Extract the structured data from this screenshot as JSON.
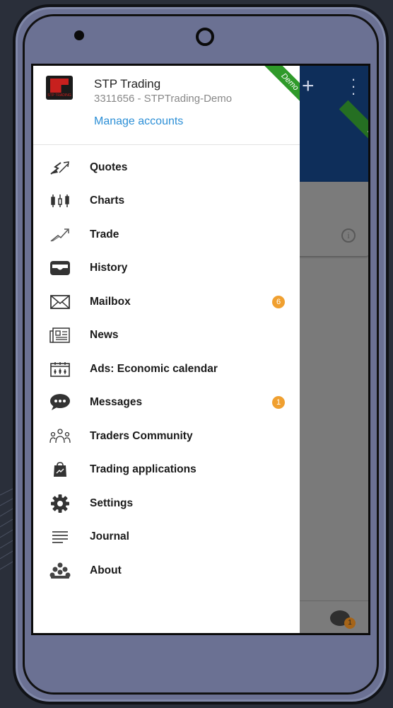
{
  "account": {
    "name": "STP Trading",
    "subtitle": "3311656 - STPTrading-Demo",
    "manage_label": "Manage accounts",
    "demo_label": "Demo",
    "logo_text": "STP TRADING"
  },
  "menu": {
    "items": [
      {
        "label": "Quotes",
        "icon": "quotes-icon"
      },
      {
        "label": "Charts",
        "icon": "candlestick-icon"
      },
      {
        "label": "Trade",
        "icon": "trade-icon"
      },
      {
        "label": "History",
        "icon": "inbox-tray-icon"
      },
      {
        "label": "Mailbox",
        "icon": "envelope-icon",
        "badge": "6"
      },
      {
        "label": "News",
        "icon": "newspaper-icon"
      },
      {
        "label": "Ads: Economic calendar",
        "icon": "calendar-icon"
      },
      {
        "label": "Messages",
        "icon": "chat-bubble-icon",
        "badge": "1"
      },
      {
        "label": "Traders Community",
        "icon": "community-icon"
      },
      {
        "label": "Trading applications",
        "icon": "app-bag-icon"
      },
      {
        "label": "Settings",
        "icon": "gear-icon"
      },
      {
        "label": "Journal",
        "icon": "lines-icon"
      },
      {
        "label": "About",
        "icon": "about-logo-icon"
      }
    ]
  },
  "background_app": {
    "demo_label": "Demo",
    "chat_badge": "1"
  },
  "colors": {
    "accent": "#2c8fd6",
    "badge": "#f0a030",
    "app_bar": "#1a53a4",
    "demo_ribbon": "#2f9a2a"
  }
}
